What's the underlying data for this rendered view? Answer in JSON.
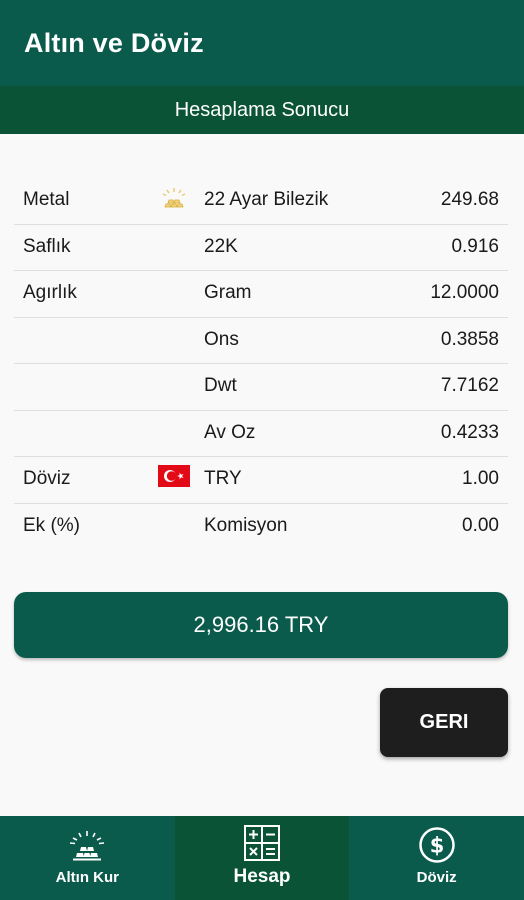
{
  "app": {
    "title": "Altın ve Döviz"
  },
  "section": {
    "title": "Hesaplama Sonucu"
  },
  "rows": [
    {
      "label": "Metal",
      "icon": "gold-bars-icon",
      "unit": "22 Ayar Bilezik",
      "value": "249.68"
    },
    {
      "label": "Saflık",
      "icon": "",
      "unit": "22K",
      "value": "0.916"
    },
    {
      "label": "Agırlık",
      "icon": "",
      "unit": "Gram",
      "value": "12.0000"
    },
    {
      "label": "",
      "icon": "",
      "unit": "Ons",
      "value": "0.3858"
    },
    {
      "label": "",
      "icon": "",
      "unit": "Dwt",
      "value": "7.7162"
    },
    {
      "label": "",
      "icon": "",
      "unit": "Av Oz",
      "value": "0.4233"
    },
    {
      "label": "Döviz",
      "icon": "turkey-flag-icon",
      "unit": "TRY",
      "value": "1.00"
    },
    {
      "label": "Ek (%)",
      "icon": "",
      "unit": "Komisyon",
      "value": "0.00"
    }
  ],
  "total": {
    "label": "2,996.16 TRY"
  },
  "actions": {
    "back_label": "GERI"
  },
  "nav": [
    {
      "label": "Altın Kur",
      "icon": "gold-bars-icon"
    },
    {
      "label": "Hesap",
      "icon": "calculator-icon"
    },
    {
      "label": "Döviz",
      "icon": "dollar-circle-icon"
    }
  ],
  "colors": {
    "primary": "#0b5b4c",
    "primary_dark": "#0b5336",
    "button_dark": "#1e1e1e",
    "flag_red": "#e30a17"
  }
}
